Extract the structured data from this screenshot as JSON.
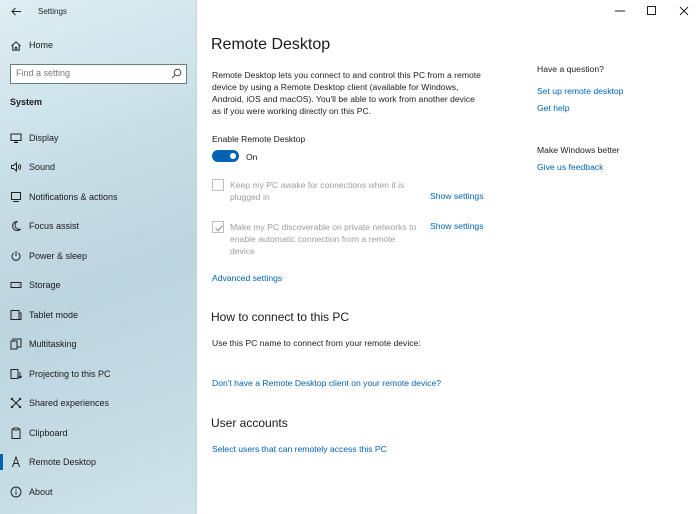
{
  "window": {
    "app_title": "Settings",
    "controls": [
      "minimize-icon",
      "maximize-icon",
      "close-icon"
    ]
  },
  "sidebar": {
    "home_label": "Home",
    "search_placeholder": "Find a setting",
    "section_header": "System",
    "items": [
      {
        "label": "Display",
        "icon": "display-icon"
      },
      {
        "label": "Sound",
        "icon": "sound-icon"
      },
      {
        "label": "Notifications & actions",
        "icon": "notifications-icon"
      },
      {
        "label": "Focus assist",
        "icon": "focus-assist-icon"
      },
      {
        "label": "Power & sleep",
        "icon": "power-icon"
      },
      {
        "label": "Storage",
        "icon": "storage-icon"
      },
      {
        "label": "Tablet mode",
        "icon": "tablet-mode-icon"
      },
      {
        "label": "Multitasking",
        "icon": "multitasking-icon"
      },
      {
        "label": "Projecting to this PC",
        "icon": "projecting-icon"
      },
      {
        "label": "Shared experiences",
        "icon": "shared-experiences-icon"
      },
      {
        "label": "Clipboard",
        "icon": "clipboard-icon"
      },
      {
        "label": "Remote Desktop",
        "icon": "remote-desktop-icon",
        "active": true
      },
      {
        "label": "About",
        "icon": "about-icon"
      }
    ],
    "accent": "#0063b1"
  },
  "main": {
    "title": "Remote Desktop",
    "description": "Remote Desktop lets you connect to and control this PC from a remote device by using a Remote Desktop client (available for Windows, Android, iOS and macOS). You'll be able to work from another device as if you were working directly on this PC.",
    "enable_label": "Enable Remote Desktop",
    "toggle_state": "On",
    "toggle_on": true,
    "option_awake": "Keep my PC awake for connections when it is plugged in",
    "option_awake_checked": false,
    "option_discoverable": "Make my PC discoverable on private networks to enable automatic connection from a remote device",
    "option_discoverable_checked": true,
    "show_settings": "Show settings",
    "advanced_settings": "Advanced settings",
    "how_to_connect_title": "How to connect to this PC",
    "how_to_connect_text": "Use this PC name to connect from your remote device:",
    "no_client_link": "Don't have a Remote Desktop client on your remote device?",
    "user_accounts_title": "User accounts",
    "select_users_link": "Select users that can remotely access this PC"
  },
  "right_column": {
    "question_header": "Have a question?",
    "setup_link": "Set up remote desktop",
    "help_link": "Get help",
    "better_header": "Make Windows better",
    "feedback_link": "Give us feedback"
  }
}
